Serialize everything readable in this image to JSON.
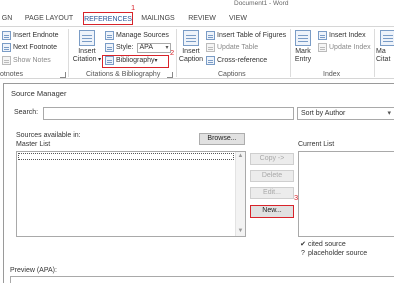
{
  "window": {
    "title": "Document1 - Word"
  },
  "ribbon_tabs": [
    {
      "label": "GN"
    },
    {
      "label": "PAGE LAYOUT"
    },
    {
      "label": "REFERENCES"
    },
    {
      "label": "MAILINGS"
    },
    {
      "label": "REVIEW"
    },
    {
      "label": "VIEW"
    }
  ],
  "step_markers": [
    "1",
    "2",
    "3"
  ],
  "ribbon": {
    "footnotes": {
      "insert_endnote": "Insert Endnote",
      "next_footnote": "Next Footnote",
      "show_notes": "Show Notes",
      "group_label": "otnotes"
    },
    "citations": {
      "insert_citation": "Insert",
      "insert_citation_2": "Citation",
      "manage_sources": "Manage Sources",
      "style_label": "Style:",
      "style_value": "APA",
      "bibliography": "Bibliography",
      "group_label": "Citations & Bibliography"
    },
    "captions": {
      "insert_caption": "Insert",
      "insert_caption_2": "Caption",
      "insert_table_of_figures": "Insert Table of Figures",
      "update_table": "Update Table",
      "cross_reference": "Cross-reference",
      "group_label": "Captions"
    },
    "index": {
      "mark_entry": "Mark",
      "mark_entry_2": "Entry",
      "insert_index": "Insert Index",
      "update_index": "Update Index",
      "group_label": "Index"
    },
    "toa": {
      "label": "Ma",
      "label_2": "Citat"
    }
  },
  "dialog": {
    "title": "Source Manager",
    "search_label": "Search:",
    "search_value": "",
    "sort_value": "Sort by Author",
    "sources_available": "Sources available in:",
    "master_list": "Master List",
    "browse_button": "Browse...",
    "current_list": "Current List",
    "buttons": {
      "copy": "Copy ->",
      "delete": "Delete",
      "edit": "Edit...",
      "new": "New..."
    },
    "legend": [
      {
        "mark": "✔",
        "text": "cited source"
      },
      {
        "mark": "?",
        "text": "placeholder source"
      }
    ],
    "preview_label": "Preview (APA):"
  },
  "colors": {
    "highlight_red": "#d8232a",
    "active_tab_text": "#2b579a"
  }
}
